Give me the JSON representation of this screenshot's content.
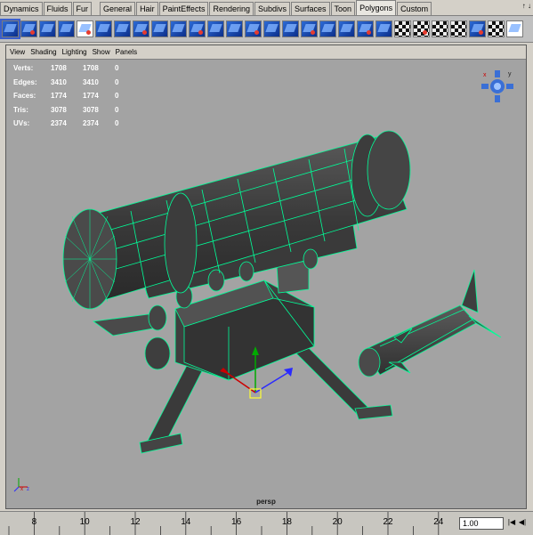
{
  "shelf_tabs": [
    "Dynamics",
    "Fluids",
    "Fur",
    "General",
    "Hair",
    "PaintEffects",
    "Rendering",
    "Subdivs",
    "Surfaces",
    "Toon",
    "Polygons",
    "Custom"
  ],
  "active_tab": "Polygons",
  "shelf_icons": [
    "sphere-icon",
    "cube-icon",
    "cylinder-icon",
    "cone-icon",
    "plane-icon",
    "torus-icon",
    "extrude-icon",
    "split-icon",
    "bevel-icon",
    "append-icon",
    "merge-icon",
    "smooth-icon",
    "cut-icon",
    "bridge-icon",
    "combine-icon",
    "separate-icon",
    "mirror-icon",
    "wedge-icon",
    "poke-icon",
    "normals-icon",
    "uv-planar-icon",
    "uv-cylindrical-icon",
    "uv-spherical-icon",
    "uv-auto-icon",
    "uv-editor-icon",
    "checker-icon",
    "layout-uv-icon",
    "unfold-icon"
  ],
  "panel_menu": [
    "View",
    "Shading",
    "Lighting",
    "Show",
    "Panels"
  ],
  "hud": [
    {
      "label": "Verts:",
      "a": "1708",
      "b": "1708",
      "c": "0"
    },
    {
      "label": "Edges:",
      "a": "3410",
      "b": "3410",
      "c": "0"
    },
    {
      "label": "Faces:",
      "a": "1774",
      "b": "1774",
      "c": "0"
    },
    {
      "label": "Tris:",
      "a": "3078",
      "b": "3078",
      "c": "0"
    },
    {
      "label": "UVs:",
      "a": "2374",
      "b": "2374",
      "c": "0"
    }
  ],
  "camera": "persp",
  "time_ticks": [
    "8",
    "10",
    "12",
    "14",
    "16",
    "18",
    "20",
    "22",
    "24"
  ],
  "current_frame": "1.00",
  "colors": {
    "viewport_bg": "#a3a3a3",
    "wire": "#00ff99",
    "mesh_dark": "#383838",
    "mesh_mid": "#4d4d4d"
  }
}
